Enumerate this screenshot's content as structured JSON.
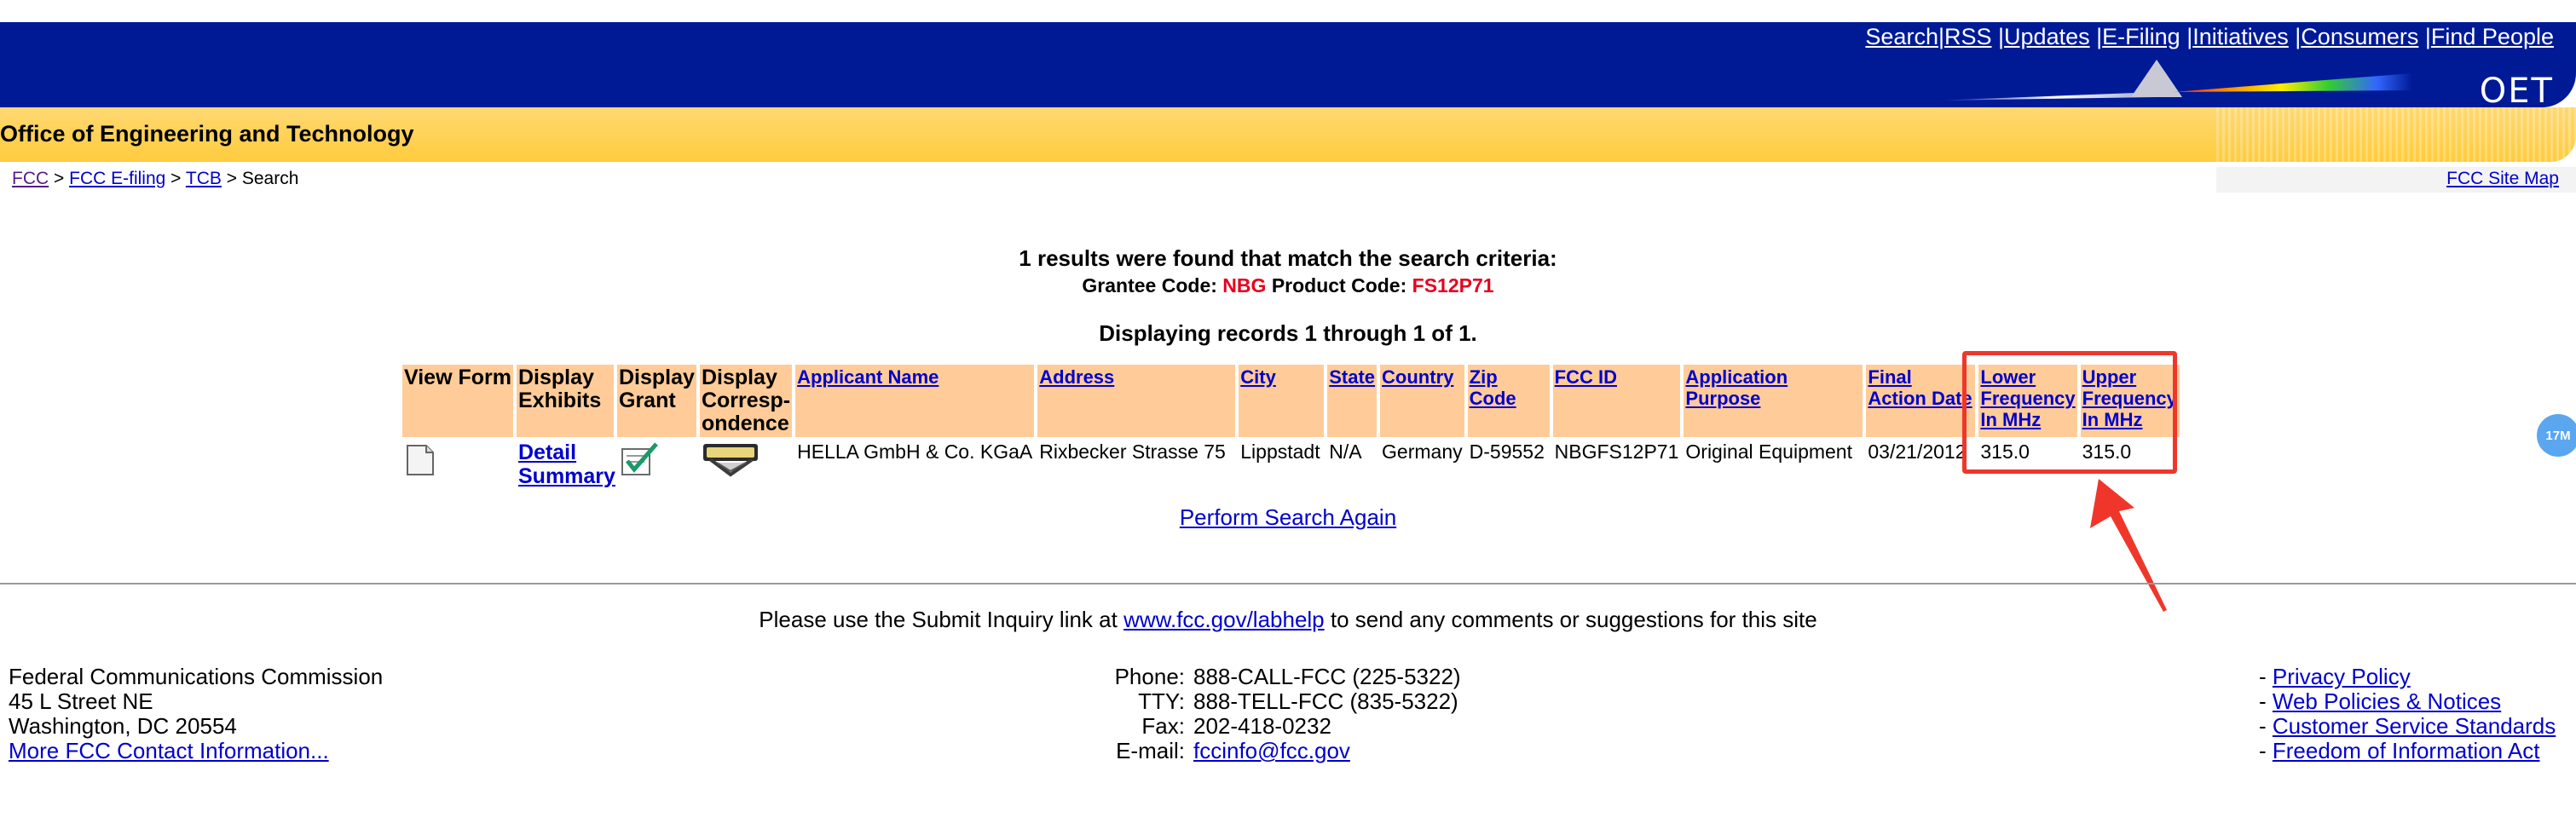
{
  "header": {
    "nav_links": [
      "Search",
      "RSS",
      "Updates",
      "E-Filing",
      "Initiatives",
      "Consumers",
      "Find People"
    ],
    "logo_text": "OET",
    "office_title": "Office of Engineering and Technology"
  },
  "breadcrumb": {
    "items": [
      "FCC",
      "FCC E-filing",
      "TCB"
    ],
    "current": "Search",
    "separator": ">",
    "site_map": "FCC Site Map"
  },
  "results": {
    "found_text": "1 results were found that match the search criteria:",
    "grantee_label": "Grantee Code:",
    "grantee_code": "NBG",
    "product_label": "Product Code:",
    "product_code": "FS12P71",
    "displaying_text": "Displaying records 1 through 1 of 1."
  },
  "table": {
    "headers": {
      "view_form": "View Form",
      "display_exhibits": "Display Exhibits",
      "display_grant": "Display Grant",
      "display_correspondence": "Display Corresp-ondence",
      "applicant_name": "Applicant Name",
      "address": "Address",
      "city": "City",
      "state": "State",
      "country": "Country",
      "zip_code": "Zip Code",
      "fcc_id": "FCC ID",
      "application_purpose": "Application Purpose",
      "final_action_date": "Final Action Date",
      "lower_frequency": "Lower Frequency In MHz",
      "upper_frequency": "Upper Frequency In MHz"
    },
    "row": {
      "exhibits_link": "Detail Summary",
      "applicant_name": "HELLA GmbH & Co. KGaA",
      "address": "Rixbecker Strasse 75",
      "city": "Lippstadt",
      "state": "N/A",
      "country": "Germany",
      "zip_code": "D-59552",
      "fcc_id": "NBGFS12P71",
      "application_purpose": "Original Equipment",
      "final_action_date": "03/21/2012",
      "lower_frequency": "315.0",
      "upper_frequency": "315.0"
    }
  },
  "search_again": "Perform Search Again",
  "inquiry": {
    "before": "Please use the Submit Inquiry link at",
    "link": "www.fcc.gov/labhelp",
    "after": "to send any comments or suggestions for this site"
  },
  "footer": {
    "address_lines": [
      "Federal Communications Commission",
      "45 L Street NE",
      "Washington, DC 20554"
    ],
    "contact_link": "More FCC Contact Information...",
    "phone_label": "Phone:",
    "phone": "888-CALL-FCC (225-5322)",
    "tty_label": "TTY:",
    "tty": "888-TELL-FCC (835-5322)",
    "fax_label": "Fax:",
    "fax": "202-418-0232",
    "email_label": "E-mail:",
    "email": "fccinfo@fcc.gov",
    "policy_links": [
      "Privacy Policy",
      "Web Policies & Notices",
      "Customer Service Standards",
      "Freedom of Information Act"
    ]
  },
  "badge": "17M",
  "colors": {
    "header_blue": "#001a96",
    "header_yellow": "#ffcc3d",
    "table_header": "#ffcc99",
    "red_text": "#e6001e",
    "highlight": "#f0362a",
    "link": "#0000cc"
  }
}
